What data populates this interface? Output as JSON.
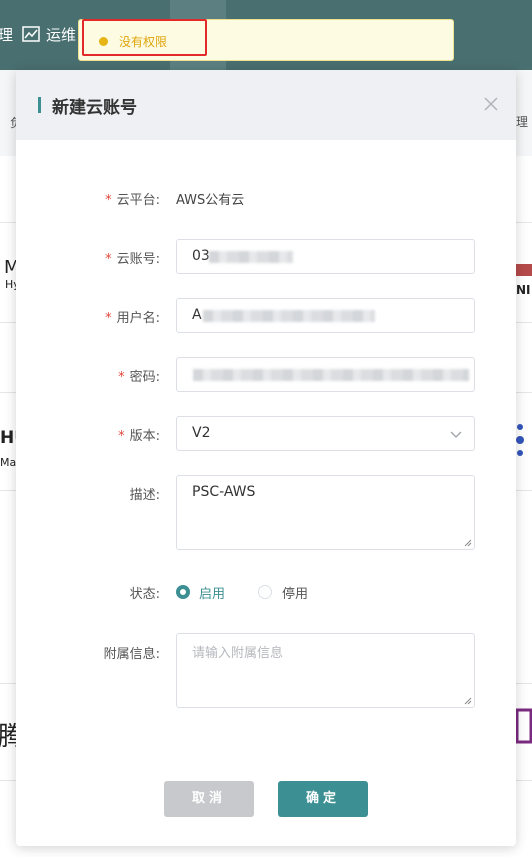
{
  "background": {
    "nav_fragment_left": "理",
    "nav_fragment_ops": "运维",
    "subnav_left": "负",
    "subnav_right": "理",
    "list_fragments": [
      "M",
      "Hy",
      "HU",
      "Ma",
      "腾"
    ],
    "right_logo_text": "NI"
  },
  "toast": {
    "text": "没有权限",
    "accent_color": "#e7b416"
  },
  "modal": {
    "title": "新建云账号",
    "close_icon": "close-icon",
    "required_mark": "*",
    "fields": {
      "platform": {
        "label": "云平台:",
        "value": "AWS公有云"
      },
      "account": {
        "label": "云账号:",
        "value": "03"
      },
      "username": {
        "label": "用户名:",
        "value": "A"
      },
      "password": {
        "label": "密码:"
      },
      "version": {
        "label": "版本:",
        "value": "V2"
      },
      "description": {
        "label": "描述:",
        "value": "PSC-AWS"
      },
      "status": {
        "label": "状态:",
        "options": [
          "启用",
          "停用"
        ],
        "selected": "启用"
      },
      "extra": {
        "label": "附属信息:",
        "placeholder": "请输入附属信息"
      }
    },
    "buttons": {
      "cancel": "取消",
      "confirm": "确定"
    },
    "accent_color": "#3c8f92"
  }
}
